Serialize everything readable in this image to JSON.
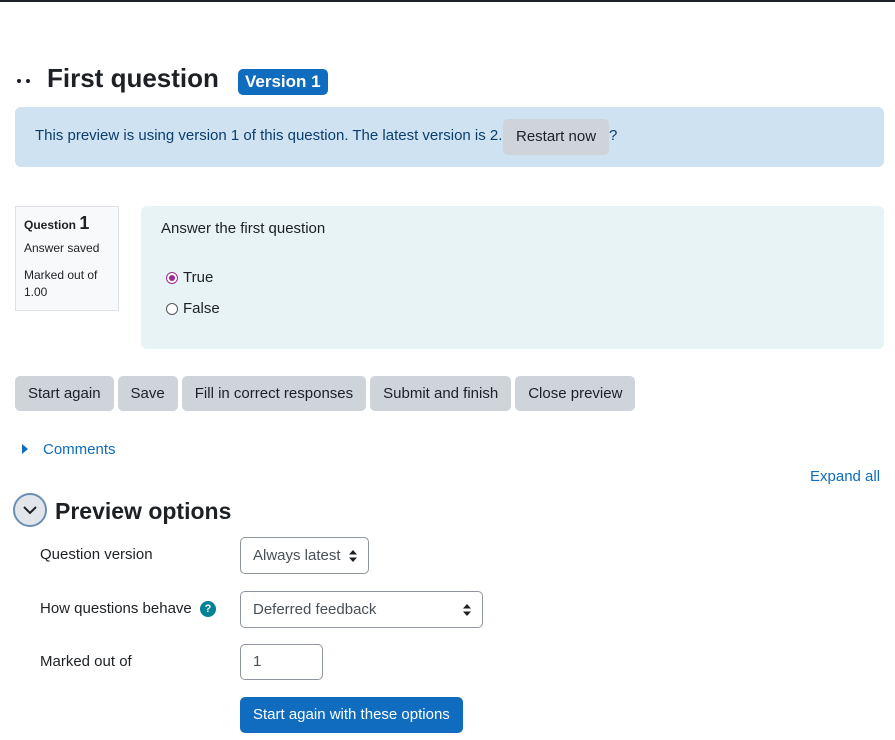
{
  "header": {
    "title": "First question",
    "version_badge": "Version 1"
  },
  "alert": {
    "text": "This preview is using version 1 of this question. The latest version is 2.",
    "restart_label": "Restart now",
    "trailing": "?"
  },
  "question_info": {
    "label": "Question",
    "number": "1",
    "state": "Answer saved",
    "grade": "Marked out of 1.00"
  },
  "question": {
    "text": "Answer the first question",
    "answers": [
      {
        "label": "True",
        "selected": true
      },
      {
        "label": "False",
        "selected": false
      }
    ]
  },
  "actions": {
    "start_again": "Start again",
    "save": "Save",
    "fill_correct": "Fill in correct responses",
    "submit_finish": "Submit and finish",
    "close_preview": "Close preview"
  },
  "comments": {
    "label": "Comments"
  },
  "expand_all": "Expand all",
  "preview_options": {
    "title": "Preview options",
    "question_version": {
      "label": "Question version",
      "value": "Always latest"
    },
    "behaviour": {
      "label": "How questions behave",
      "help": "?",
      "value": "Deferred feedback"
    },
    "marked_out_of": {
      "label": "Marked out of",
      "value": "1"
    },
    "submit_label": "Start again with these options"
  },
  "colors": {
    "primary": "#0f6cbf",
    "alert_bg": "#cfe2f1",
    "question_bg": "#e7f3f5",
    "radio_selected": "#9b2c92",
    "help_icon": "#008196"
  }
}
